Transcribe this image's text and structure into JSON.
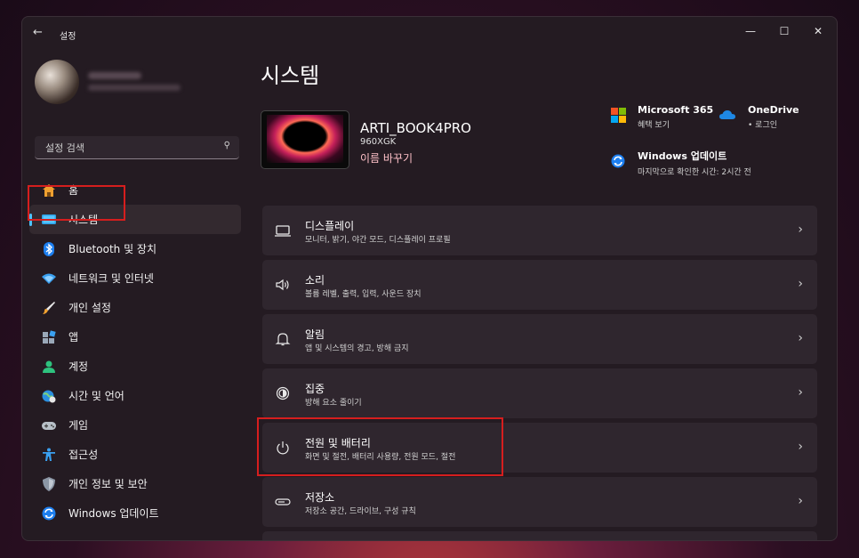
{
  "window": {
    "title": "설정",
    "back_glyph": "←",
    "min_glyph": "—",
    "max_glyph": "☐",
    "close_glyph": "✕"
  },
  "search": {
    "placeholder": "설정 검색",
    "icon_glyph": "⚲"
  },
  "sidebar": {
    "items": [
      {
        "label": "홈",
        "icon": "home-icon",
        "active": false
      },
      {
        "label": "시스템",
        "icon": "monitor-icon",
        "active": true
      },
      {
        "label": "Bluetooth 및 장치",
        "icon": "bluetooth-icon",
        "active": false
      },
      {
        "label": "네트워크 및 인터넷",
        "icon": "wifi-icon",
        "active": false
      },
      {
        "label": "개인 설정",
        "icon": "brush-icon",
        "active": false
      },
      {
        "label": "앱",
        "icon": "apps-icon",
        "active": false
      },
      {
        "label": "계정",
        "icon": "person-icon",
        "active": false
      },
      {
        "label": "시간 및 언어",
        "icon": "globe-clock-icon",
        "active": false
      },
      {
        "label": "게임",
        "icon": "gamepad-icon",
        "active": false
      },
      {
        "label": "접근성",
        "icon": "accessibility-icon",
        "active": false
      },
      {
        "label": "개인 정보 및 보안",
        "icon": "shield-icon",
        "active": false
      },
      {
        "label": "Windows 업데이트",
        "icon": "update-icon",
        "active": false
      }
    ]
  },
  "main": {
    "title": "시스템",
    "device": {
      "name": "ARTI_BOOK4PRO",
      "model": "960XGK",
      "rename": "이름 바꾸기"
    },
    "quick": {
      "m365": {
        "title": "Microsoft 365",
        "sub": "혜택 보기"
      },
      "onedrive": {
        "title": "OneDrive",
        "sub": "• 로그인"
      },
      "update": {
        "title": "Windows 업데이트",
        "sub": "마지막으로 확인한 시간: 2시간 전"
      }
    },
    "cards": [
      {
        "title": "디스플레이",
        "sub": "모니터, 밝기, 야간 모드, 디스플레이 프로필",
        "icon": "display-icon"
      },
      {
        "title": "소리",
        "sub": "볼륨 레벨, 출력, 입력, 사운드 장치",
        "icon": "speaker-icon"
      },
      {
        "title": "알림",
        "sub": "앱 및 시스템의 경고, 방해 금지",
        "icon": "bell-icon"
      },
      {
        "title": "집중",
        "sub": "방해 요소 줄이기",
        "icon": "focus-icon"
      },
      {
        "title": "전원 및 배터리",
        "sub": "화면 및 절전, 배터리 사용량, 전원 모드, 절전",
        "icon": "power-icon"
      },
      {
        "title": "저장소",
        "sub": "저장소 공간, 드라이브, 구성 규칙",
        "icon": "storage-icon"
      }
    ],
    "chevron": "›"
  },
  "colors": {
    "accent": "#4cc2ff",
    "highlight": "#d61e1e",
    "window_bg": "#241b22",
    "card_bg": "#2f262e"
  }
}
